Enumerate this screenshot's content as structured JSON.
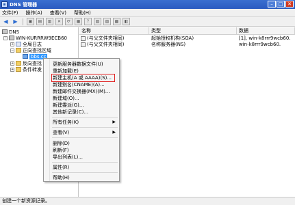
{
  "window": {
    "title": "DNS 管理器",
    "minimize": "–",
    "maximize": "□",
    "close": "✕"
  },
  "menubar": [
    "文件(F)",
    "操作(A)",
    "查看(V)",
    "帮助(H)"
  ],
  "toolbar": {
    "buttons": [
      {
        "name": "back",
        "glyph": "◀"
      },
      {
        "name": "forward",
        "glyph": "▶"
      },
      {
        "name": "up",
        "glyph": "▣"
      },
      {
        "name": "show-tree",
        "glyph": "▤"
      },
      {
        "name": "copy",
        "glyph": "▥"
      },
      {
        "name": "delete",
        "glyph": "✕"
      },
      {
        "name": "refresh",
        "glyph": "⟳"
      },
      {
        "name": "export",
        "glyph": "▦"
      },
      {
        "name": "help",
        "glyph": "?"
      },
      {
        "name": "props",
        "glyph": "▧"
      },
      {
        "name": "tool-a",
        "glyph": "▨"
      },
      {
        "name": "tool-b",
        "glyph": "▩"
      },
      {
        "name": "tool-c",
        "glyph": "◧"
      }
    ]
  },
  "tree": {
    "root": "DNS",
    "server": "WIN-KURRRW9ECB60",
    "global_logs": "全局日志",
    "forward_zones": "正向查找区域",
    "zone": "bbs.cc",
    "reverse_zones": "反向查找",
    "conditional_forwarders": "条件转发"
  },
  "list": {
    "columns": [
      "名称",
      "类型",
      "数据"
    ],
    "rows": [
      {
        "name": "(与父文件夹相同)",
        "type": "起始授权机构(SOA)",
        "data": "[1], win-k8rrr9wcb60."
      },
      {
        "name": "(与父文件夹相同)",
        "type": "名称服务器(NS)",
        "data": "win-k8rrr9wcb60."
      }
    ]
  },
  "context_menu": {
    "items": [
      "更新服务器数据文件(U)",
      "重新加载(E)",
      "新建主机(A 或 AAAA)(S)...",
      "新建别名(CNAME)(A)...",
      "新建邮件交换器(MX)(M)...",
      "新建域(O)...",
      "新建委派(G)...",
      "其他新记录(C)...",
      "所有任务(K)",
      "查看(V)",
      "删除(D)",
      "刷新(F)",
      "导出列表(L)...",
      "属性(R)",
      "帮助(H)"
    ],
    "submenu_arrow": "▶"
  },
  "statusbar": {
    "text": "创建一个新资源记录。"
  }
}
